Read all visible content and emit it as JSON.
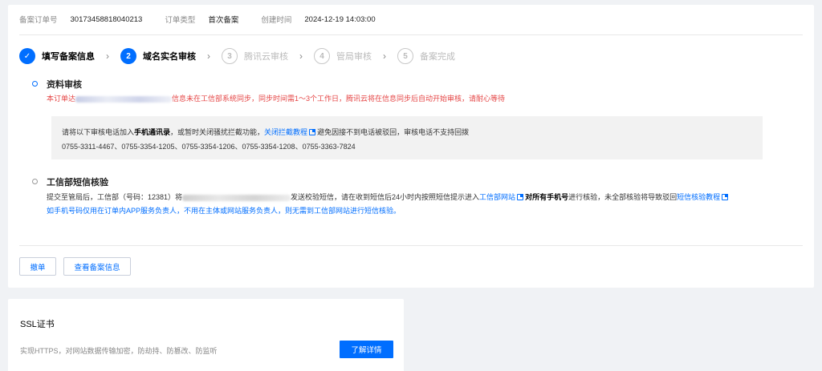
{
  "order": {
    "id_label": "备案订单号",
    "id_value": "30173458818040213",
    "type_label": "订单类型",
    "type_value": "首次备案",
    "created_label": "创建时间",
    "created_value": "2024-12-19 14:03:00"
  },
  "steps": [
    {
      "num": "✓",
      "label": "填写备案信息",
      "state": "done"
    },
    {
      "num": "2",
      "label": "域名实名审核",
      "state": "active"
    },
    {
      "num": "3",
      "label": "腾讯云审核",
      "state": "todo"
    },
    {
      "num": "4",
      "label": "管局审核",
      "state": "todo"
    },
    {
      "num": "5",
      "label": "备案完成",
      "state": "todo"
    }
  ],
  "review": {
    "title": "资料审核",
    "warning_prefix": "本订单达",
    "warning_suffix": "信息未在工信部系统同步，同步时间需1～3个工作日，腾讯云将在信息同步后自动开始审核，请耐心等待",
    "notice_line1_a": "请将以下审核电话加入",
    "notice_line1_bold": "手机通讯录",
    "notice_line1_b": "，或暂时关闭骚扰拦截功能，",
    "notice_line1_link": "关闭拦截教程",
    "notice_line1_c": "避免因接不到电话被驳回，审核电话不支持回拨",
    "phones": "0755-3311-4467、0755-3354-1205、0755-3354-1206、0755-3354-1208、0755-3363-7824"
  },
  "sms": {
    "title": "工信部短信核验",
    "line1_a": "提交至管局后，工信部（号码：12381）将",
    "line1_b": "发送校验短信，请在收到短信后24小时内按照短信提示进入",
    "line1_link1": "工信部网站",
    "line1_bold": "对所有手机号",
    "line1_c": "进行核验，未全部核验将导致驳回",
    "line1_link2": "短信核验教程",
    "line2": "如手机号码仅用在订单内APP服务负责人，不用在主体或网站服务负责人，则无需到工信部网站进行短信核验。"
  },
  "actions": {
    "withdraw": "撤单",
    "view_info": "查看备案信息"
  },
  "ssl": {
    "title": "SSL证书",
    "desc": "实现HTTPS，对网站数据传输加密，防劫持、防篡改、防监听",
    "button": "了解详情"
  }
}
